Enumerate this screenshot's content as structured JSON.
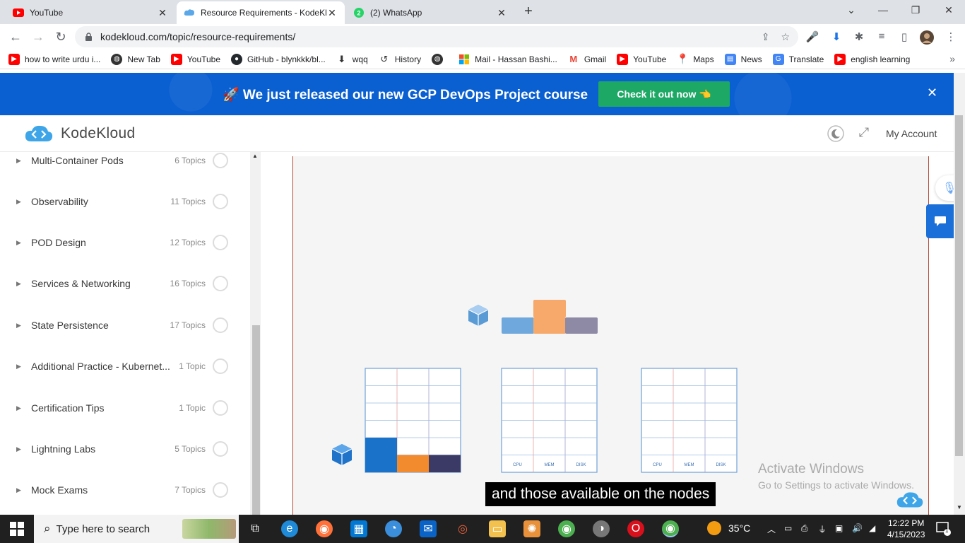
{
  "tabs": [
    {
      "title": "YouTube",
      "active": false
    },
    {
      "title": "Resource Requirements - KodeKl",
      "active": true
    },
    {
      "title": "(2) WhatsApp",
      "active": false
    }
  ],
  "address": {
    "url": "kodekloud.com/topic/resource-requirements/"
  },
  "bookmarks": [
    {
      "label": "how to write urdu i...",
      "icon": "youtube-icon",
      "color": "#ff0000"
    },
    {
      "label": "New Tab",
      "icon": "globe-icon",
      "color": "#333333"
    },
    {
      "label": "YouTube",
      "icon": "youtube-icon",
      "color": "#ff0000"
    },
    {
      "label": "GitHub - blynkkk/bl...",
      "icon": "github-icon",
      "color": "#24292e"
    },
    {
      "label": "wqq",
      "icon": "download-icon",
      "color": "#333333"
    },
    {
      "label": "History",
      "icon": "history-icon",
      "color": "#333333"
    },
    {
      "label": "",
      "icon": "globe-icon",
      "color": "#333333"
    },
    {
      "label": "Mail - Hassan Bashi...",
      "icon": "microsoft-icon",
      "color": "#f25022"
    },
    {
      "label": "Gmail",
      "icon": "gmail-icon",
      "color": "#ea4335"
    },
    {
      "label": "YouTube",
      "icon": "youtube-icon",
      "color": "#ff0000"
    },
    {
      "label": "Maps",
      "icon": "maps-icon",
      "color": "#34a853"
    },
    {
      "label": "News",
      "icon": "news-icon",
      "color": "#4285f4"
    },
    {
      "label": "Translate",
      "icon": "translate-icon",
      "color": "#4285f4"
    },
    {
      "label": "english learning",
      "icon": "youtube-icon",
      "color": "#ff0000"
    }
  ],
  "banner": {
    "text": "🚀 We just released our new GCP DevOps Project course",
    "button": "Check it out now 👈"
  },
  "header": {
    "logo_text": "KodeKloud",
    "account": "My Account"
  },
  "sidebar": {
    "items": [
      {
        "label": "Multi-Container Pods",
        "count": "6 Topics"
      },
      {
        "label": "Observability",
        "count": "11 Topics"
      },
      {
        "label": "POD Design",
        "count": "12 Topics"
      },
      {
        "label": "Services & Networking",
        "count": "16 Topics"
      },
      {
        "label": "State Persistence",
        "count": "17 Topics"
      },
      {
        "label": "Additional Practice - Kubernet...",
        "count": "1 Topic"
      },
      {
        "label": "Certification Tips",
        "count": "1 Topic"
      },
      {
        "label": "Lightning Labs",
        "count": "5 Topics"
      },
      {
        "label": "Mock Exams",
        "count": "7 Topics"
      }
    ]
  },
  "video": {
    "caption": "and those available on the nodes",
    "grid_labels": [
      "CPU",
      "MEM",
      "DISK"
    ],
    "watermark_title": "Activate Windows",
    "watermark_sub": "Go to Settings to activate Windows."
  },
  "taskbar": {
    "search_placeholder": "Type here to search",
    "weather": "35°C",
    "time": "12:22 PM",
    "date": "4/15/2023",
    "notification_count": "1"
  }
}
